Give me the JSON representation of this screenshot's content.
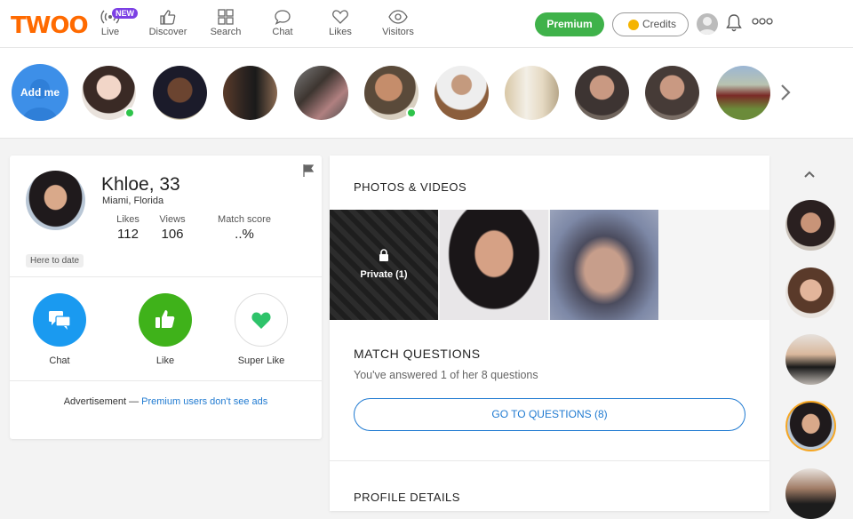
{
  "logo": "TWOO",
  "nav": {
    "items": [
      {
        "label": "Live",
        "icon": "live-broadcast-icon",
        "badge": "NEW"
      },
      {
        "label": "Discover",
        "icon": "thumbs-up-icon"
      },
      {
        "label": "Search",
        "icon": "grid-icon"
      },
      {
        "label": "Chat",
        "icon": "chat-bubble-icon"
      },
      {
        "label": "Likes",
        "icon": "heart-icon"
      },
      {
        "label": "Visitors",
        "icon": "eye-icon"
      }
    ],
    "premium_label": "Premium",
    "credits_label": "Credits"
  },
  "strip": {
    "add_me_label": "Add me"
  },
  "profile": {
    "name": "Khloe, 33",
    "location": "Miami, Florida",
    "stats": [
      {
        "label": "Likes",
        "value": "112"
      },
      {
        "label": "Views",
        "value": "106"
      },
      {
        "label": "Match score",
        "value": "..%"
      }
    ],
    "badge": "Here to date",
    "actions": [
      {
        "label": "Chat",
        "color": "#1a9af0"
      },
      {
        "label": "Like",
        "color": "#3fb21a"
      },
      {
        "label": "Super Like",
        "color": "#2ec36a"
      }
    ],
    "ad_prefix": "Advertisement —",
    "ad_link": "Premium users don't see ads"
  },
  "main": {
    "photos_title": "PHOTOS & VIDEOS",
    "private_label": "Private (1)",
    "mq_title": "MATCH QUESTIONS",
    "mq_sub": "You've answered 1 of her 8 questions",
    "mq_button": "GO TO QUESTIONS (8)",
    "details_title": "PROFILE DETAILS"
  },
  "colors": {
    "brand": "#ff6a00",
    "premium": "#3fb24a",
    "link": "#1f7ad1",
    "online": "#2ec34a"
  }
}
